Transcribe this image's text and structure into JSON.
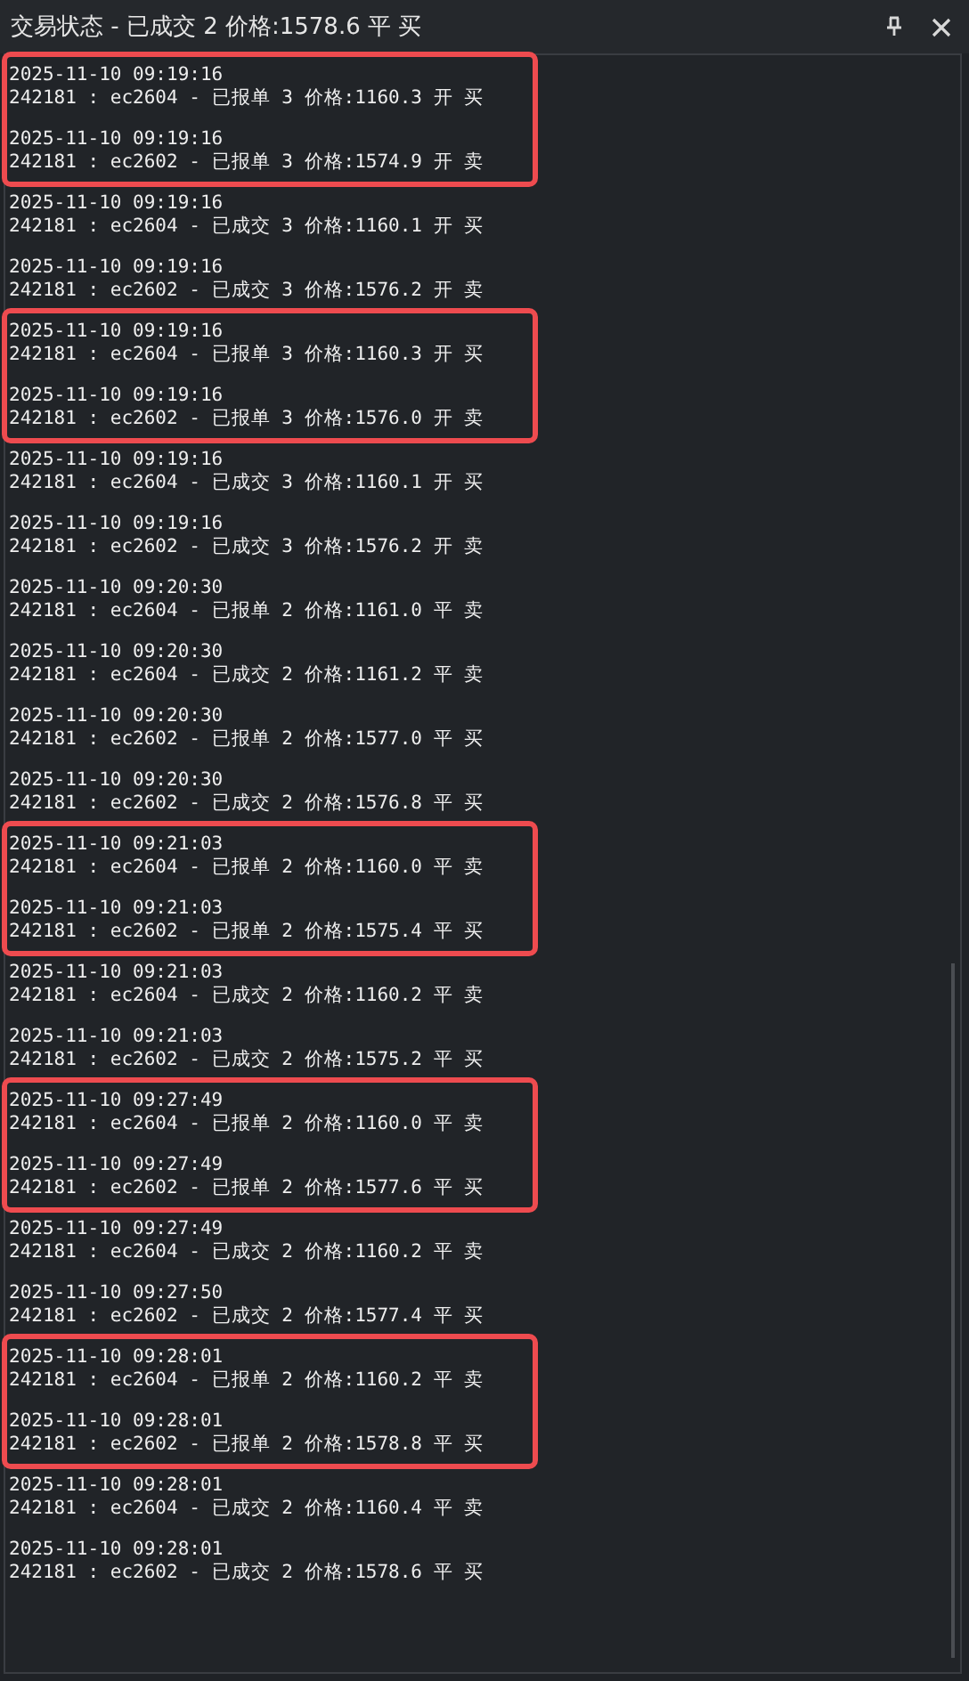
{
  "window": {
    "title": "交易状态 - 已成交 2 价格:1578.6 平 买"
  },
  "groups": [
    {
      "highlighted": true,
      "entries": [
        {
          "timestamp": "2025-11-10 09:19:16",
          "message": "242181 : ec2604 - 已报单 3 价格:1160.3 开 买"
        },
        {
          "timestamp": "2025-11-10 09:19:16",
          "message": "242181 : ec2602 - 已报单 3 价格:1574.9 开 卖"
        }
      ]
    },
    {
      "highlighted": false,
      "entries": [
        {
          "timestamp": "2025-11-10 09:19:16",
          "message": "242181 : ec2604 - 已成交 3 价格:1160.1 开 买"
        },
        {
          "timestamp": "2025-11-10 09:19:16",
          "message": "242181 : ec2602 - 已成交 3 价格:1576.2 开 卖"
        }
      ]
    },
    {
      "highlighted": true,
      "entries": [
        {
          "timestamp": "2025-11-10 09:19:16",
          "message": "242181 : ec2604 - 已报单 3 价格:1160.3 开 买"
        },
        {
          "timestamp": "2025-11-10 09:19:16",
          "message": "242181 : ec2602 - 已报单 3 价格:1576.0 开 卖"
        }
      ]
    },
    {
      "highlighted": false,
      "entries": [
        {
          "timestamp": "2025-11-10 09:19:16",
          "message": "242181 : ec2604 - 已成交 3 价格:1160.1 开 买"
        },
        {
          "timestamp": "2025-11-10 09:19:16",
          "message": "242181 : ec2602 - 已成交 3 价格:1576.2 开 卖"
        },
        {
          "timestamp": "2025-11-10 09:20:30",
          "message": "242181 : ec2604 - 已报单 2 价格:1161.0 平 卖"
        },
        {
          "timestamp": "2025-11-10 09:20:30",
          "message": "242181 : ec2604 - 已成交 2 价格:1161.2 平 卖"
        },
        {
          "timestamp": "2025-11-10 09:20:30",
          "message": "242181 : ec2602 - 已报单 2 价格:1577.0 平 买"
        },
        {
          "timestamp": "2025-11-10 09:20:30",
          "message": "242181 : ec2602 - 已成交 2 价格:1576.8 平 买"
        }
      ]
    },
    {
      "highlighted": true,
      "entries": [
        {
          "timestamp": "2025-11-10 09:21:03",
          "message": "242181 : ec2604 - 已报单 2 价格:1160.0 平 卖"
        },
        {
          "timestamp": "2025-11-10 09:21:03",
          "message": "242181 : ec2602 - 已报单 2 价格:1575.4 平 买"
        }
      ]
    },
    {
      "highlighted": false,
      "entries": [
        {
          "timestamp": "2025-11-10 09:21:03",
          "message": "242181 : ec2604 - 已成交 2 价格:1160.2 平 卖"
        },
        {
          "timestamp": "2025-11-10 09:21:03",
          "message": "242181 : ec2602 - 已成交 2 价格:1575.2 平 买"
        }
      ]
    },
    {
      "highlighted": true,
      "entries": [
        {
          "timestamp": "2025-11-10 09:27:49",
          "message": "242181 : ec2604 - 已报单 2 价格:1160.0 平 卖"
        },
        {
          "timestamp": "2025-11-10 09:27:49",
          "message": "242181 : ec2602 - 已报单 2 价格:1577.6 平 买"
        }
      ]
    },
    {
      "highlighted": false,
      "entries": [
        {
          "timestamp": "2025-11-10 09:27:49",
          "message": "242181 : ec2604 - 已成交 2 价格:1160.2 平 卖"
        },
        {
          "timestamp": "2025-11-10 09:27:50",
          "message": "242181 : ec2602 - 已成交 2 价格:1577.4 平 买"
        }
      ]
    },
    {
      "highlighted": true,
      "entries": [
        {
          "timestamp": "2025-11-10 09:28:01",
          "message": "242181 : ec2604 - 已报单 2 价格:1160.2 平 卖"
        },
        {
          "timestamp": "2025-11-10 09:28:01",
          "message": "242181 : ec2602 - 已报单 2 价格:1578.8 平 买"
        }
      ]
    },
    {
      "highlighted": false,
      "entries": [
        {
          "timestamp": "2025-11-10 09:28:01",
          "message": "242181 : ec2604 - 已成交 2 价格:1160.4 平 卖"
        },
        {
          "timestamp": "2025-11-10 09:28:01",
          "message": "242181 : ec2602 - 已成交 2 价格:1578.6 平 买"
        }
      ]
    }
  ]
}
